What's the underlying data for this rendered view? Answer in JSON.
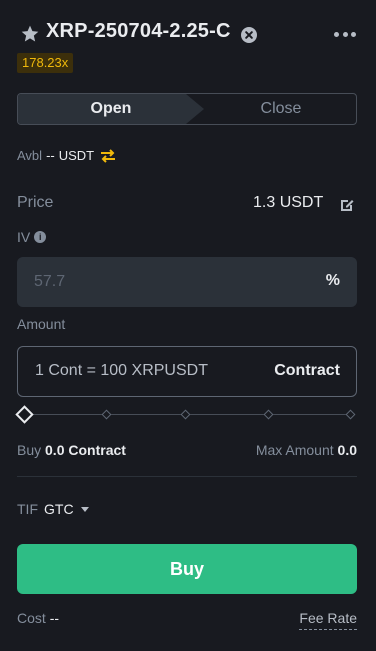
{
  "header": {
    "symbol": "XRP-250704-2.25-C",
    "leverage": "178.23x",
    "icons": [
      "star-icon",
      "close-circle-icon",
      "more-icon"
    ]
  },
  "tabs": [
    {
      "label": "Open",
      "active": true
    },
    {
      "label": "Close",
      "active": false
    }
  ],
  "avbl": {
    "label": "Avbl",
    "value": "--",
    "unit": "USDT",
    "icon": "swap-icon"
  },
  "price": {
    "label": "Price",
    "value": "1.3 USDT",
    "icon": "edit-icon"
  },
  "iv": {
    "label": "IV",
    "value": "57.7",
    "unit": "%"
  },
  "amount": {
    "label": "Amount",
    "placeholder": "1 Cont = 100 XRPUSDT",
    "unit": "Contract",
    "slider_percent": 0
  },
  "summary": {
    "buy_label": "Buy",
    "buy_value": "0.0 Contract",
    "max_label": "Max Amount",
    "max_value": "0.0"
  },
  "tif": {
    "label": "TIF",
    "value": "GTC"
  },
  "buy_button": "Buy",
  "cost": {
    "label": "Cost",
    "value": "--"
  },
  "fee_rate": "Fee Rate",
  "colors": {
    "background": "#181a20",
    "buy_green": "#2ebd85",
    "accent_yellow": "#f0b90b",
    "input_bg": "#2b3139"
  }
}
